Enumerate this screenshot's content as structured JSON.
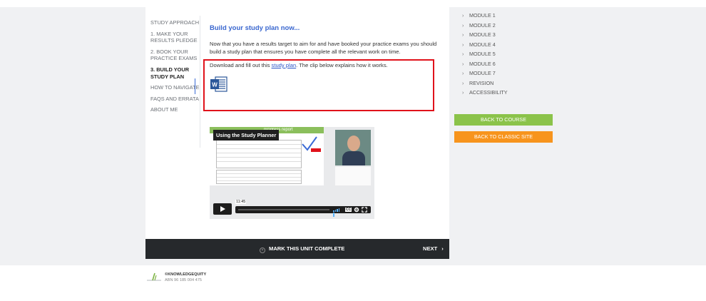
{
  "unit_nav": {
    "items": [
      {
        "label": "STUDY APPROACH"
      },
      {
        "label": "1. MAKE YOUR RESULTS PLEDGE"
      },
      {
        "label": "2. BOOK YOUR PRACTICE EXAMS"
      },
      {
        "label": "3. BUILD YOUR STUDY PLAN",
        "active": true
      },
      {
        "label": "HOW TO NAVIGATE"
      },
      {
        "label": "FAQS AND ERRATA"
      },
      {
        "label": "ABOUT ME"
      }
    ]
  },
  "content": {
    "title": "Build your study plan now...",
    "paragraph1": "Now that you have a results target to aim for and have booked your practice exams you should build a study plan that ensures you have complete all the relevant work on time.",
    "paragraph2_before": "Download and fill out this ",
    "paragraph2_link": "study plan",
    "paragraph2_after": ". The clip below explains how it works.",
    "file_icon": "word-document-icon"
  },
  "video": {
    "title": "Using the Study Planner",
    "slide_header": "progress report",
    "timestamp": "11:45",
    "cc_label": "CC",
    "icons": [
      "play-icon",
      "volume-icon",
      "cc-icon",
      "gear-icon",
      "fullscreen-icon"
    ]
  },
  "bottom_bar": {
    "complete_label": "MARK THIS UNIT COMPLETE",
    "next_label": "NEXT",
    "next_chevron": "›"
  },
  "modules": {
    "items": [
      {
        "label": "MODULE 1"
      },
      {
        "label": "MODULE 2"
      },
      {
        "label": "MODULE 3"
      },
      {
        "label": "MODULE 4"
      },
      {
        "label": "MODULE 5"
      },
      {
        "label": "MODULE 6"
      },
      {
        "label": "MODULE 7"
      },
      {
        "label": "REVISION"
      },
      {
        "label": "ACCESSIBILITY"
      }
    ],
    "chevron": "›"
  },
  "buttons": {
    "back_to_course": "BACK TO COURSE",
    "back_to_classic": "BACK TO CLASSIC SITE"
  },
  "footer": {
    "brand": "©KNOWLEDGEQUITY",
    "abn": "ABN 96 185 004 475"
  },
  "colors": {
    "accent_blue": "#3a67cf",
    "highlight_red": "#e0121b",
    "green": "#8bc34a",
    "orange": "#f7941d",
    "bar_dark": "#26292c"
  }
}
